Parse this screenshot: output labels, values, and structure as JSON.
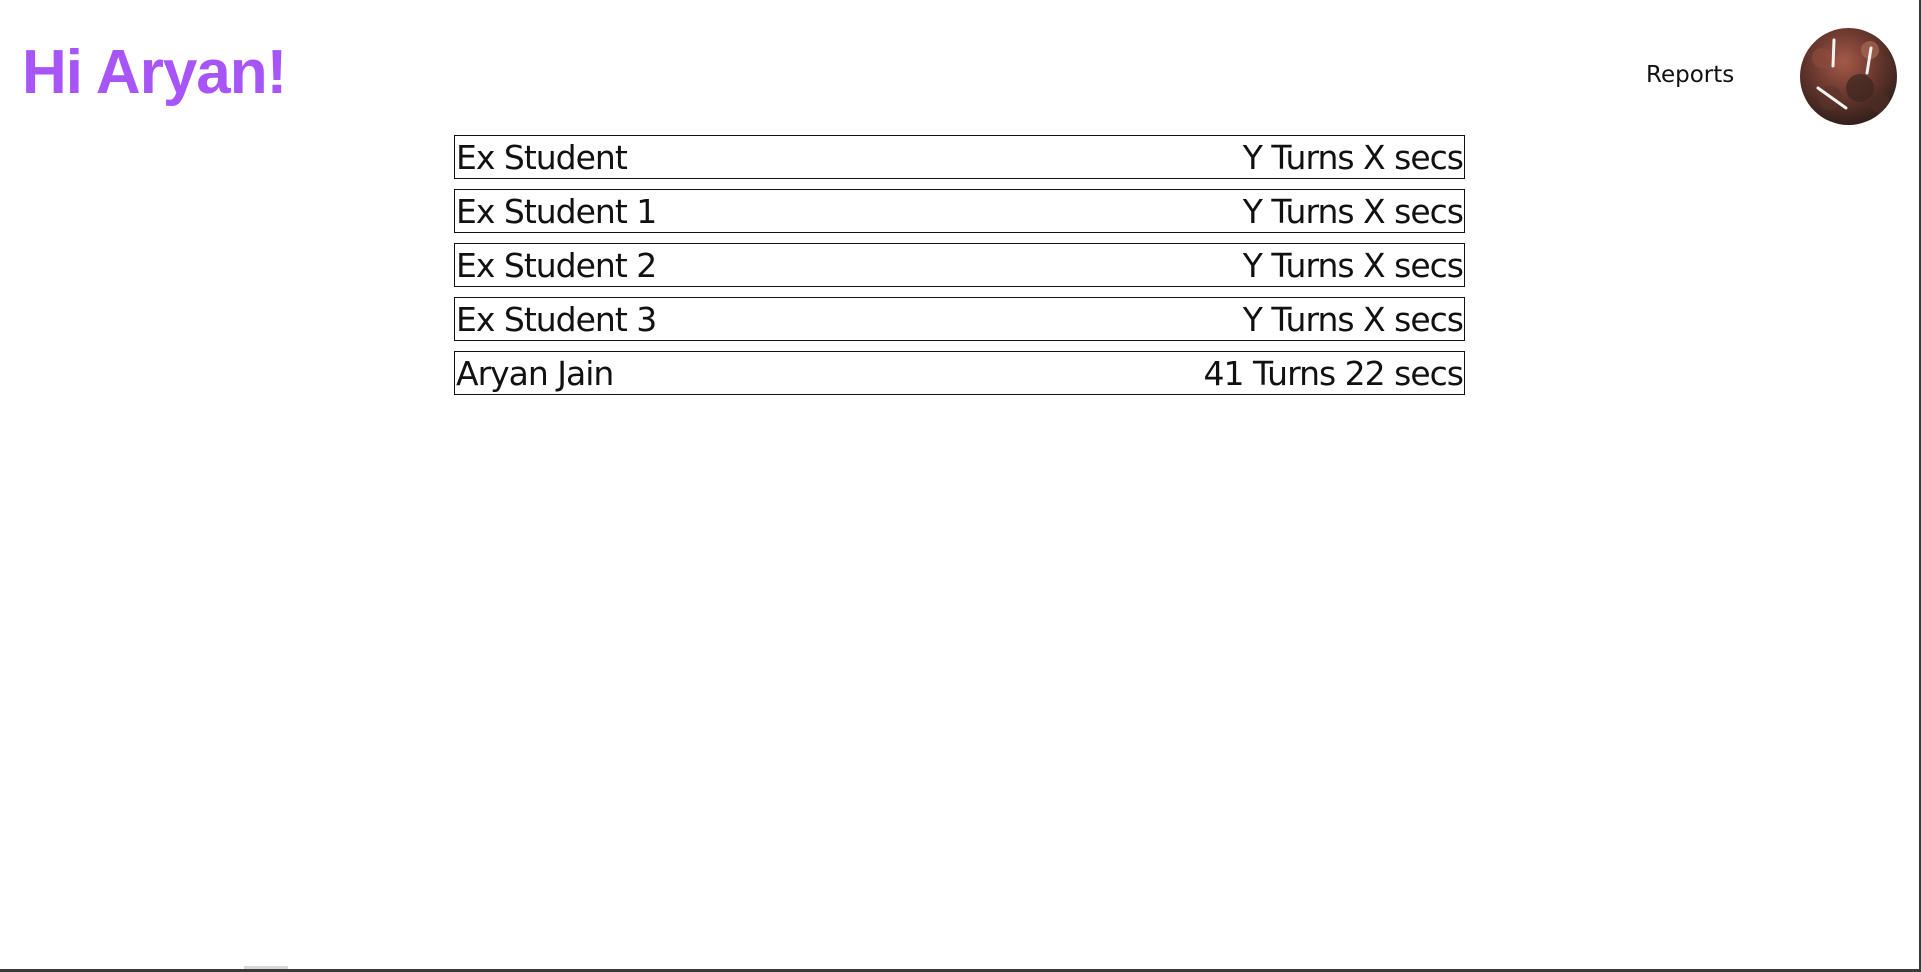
{
  "header": {
    "greeting": "Hi Aryan!",
    "greeting_color": "#a855f7",
    "nav": {
      "reports_label": "Reports"
    },
    "avatar": {
      "icon": "profile-photo-avatar"
    }
  },
  "leaderboard": {
    "rows": [
      {
        "name": "Ex Student",
        "score": "Y Turns X secs"
      },
      {
        "name": "Ex Student 1",
        "score": "Y Turns X secs"
      },
      {
        "name": "Ex Student 2",
        "score": "Y Turns X secs"
      },
      {
        "name": "Ex Student 3",
        "score": "Y Turns X secs"
      },
      {
        "name": "Aryan Jain",
        "score": "41 Turns 22 secs"
      }
    ]
  }
}
